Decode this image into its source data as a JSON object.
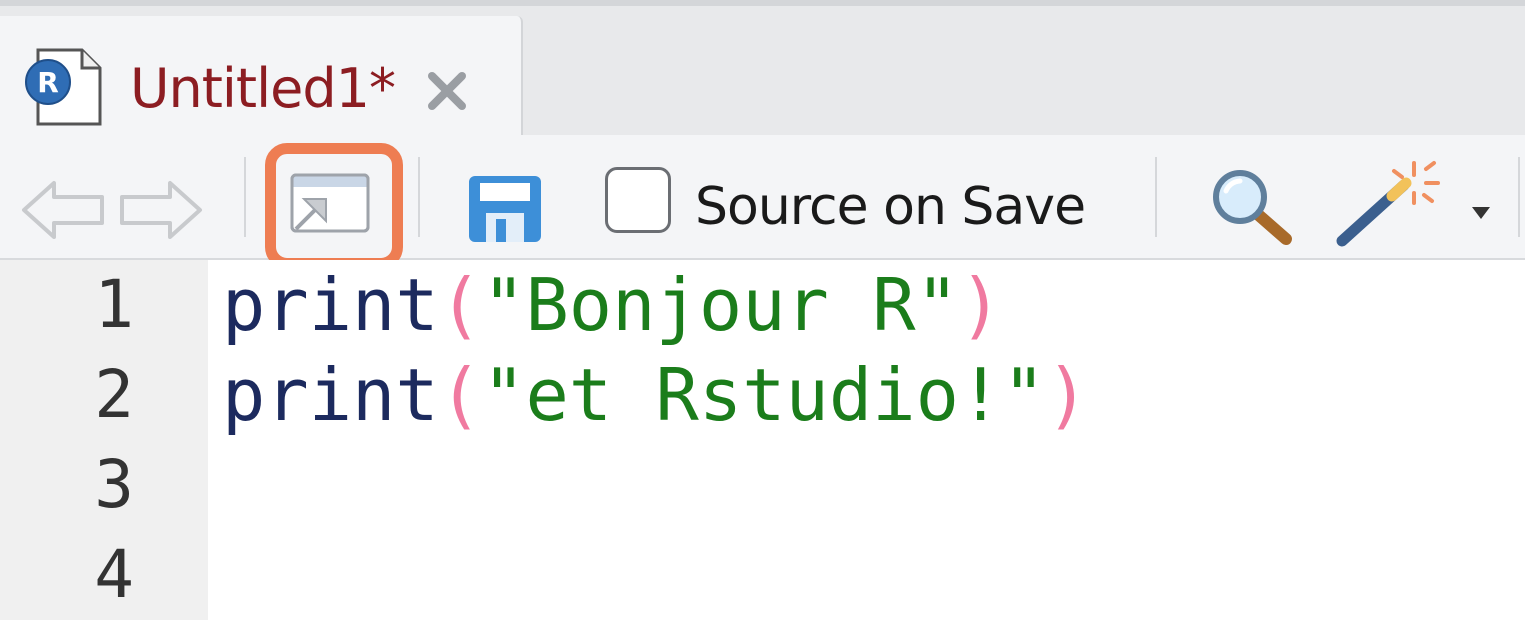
{
  "tab": {
    "title": "Untitled1*",
    "file_icon": "r-script-file-icon",
    "close_icon": "close-icon"
  },
  "toolbar": {
    "back_icon": "arrow-left-icon",
    "forward_icon": "arrow-right-icon",
    "show_in_window_icon": "show-in-new-window-icon",
    "save_icon": "floppy-disk-icon",
    "source_on_save_label": "Source on Save",
    "source_on_save_checked": false,
    "find_icon": "magnifier-icon",
    "code_tools_icon": "magic-wand-icon",
    "dropdown_icon": "caret-down-icon"
  },
  "editor": {
    "line_numbers": [
      "1",
      "2",
      "3",
      "4"
    ],
    "lines": [
      {
        "fn": "print",
        "open": "(",
        "str": "\"Bonjour R\"",
        "close": ")"
      },
      {
        "fn": "print",
        "open": "(",
        "str": "\"et Rstudio!\"",
        "close": ")"
      }
    ]
  },
  "colors": {
    "tab_title": "#8c1d22",
    "highlight_border": "#ee7d52",
    "code_function": "#1c2a5e",
    "code_string": "#1b7d1b",
    "code_paren": "#f07aa0",
    "save_icon_blue": "#3d8fd8"
  }
}
